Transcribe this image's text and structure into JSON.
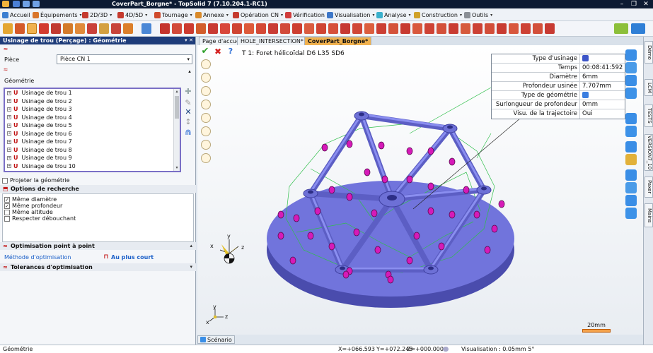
{
  "window": {
    "title": "CoverPart_Borgne* - TopSolid 7 (7.10.204.1-RC1)",
    "controls": [
      "–",
      "❐",
      "✕"
    ]
  },
  "menu": [
    {
      "label": "Accueil",
      "icon": "home-icon"
    },
    {
      "label": "Équipements",
      "icon": "equipment-icon"
    },
    {
      "label": "2D/3D",
      "icon": "2d3d-icon"
    },
    {
      "label": "4D/5D",
      "icon": "4d5d-icon"
    },
    {
      "label": "Tournage",
      "icon": "turning-icon"
    },
    {
      "label": "Annexe",
      "icon": "annex-icon"
    },
    {
      "label": "Opération CN",
      "icon": "cn-operation-icon"
    },
    {
      "label": "Vérification",
      "icon": "verification-icon"
    },
    {
      "label": "Visualisation",
      "icon": "visualisation-icon"
    },
    {
      "label": "Analyse",
      "icon": "analysis-icon"
    },
    {
      "label": "Construction",
      "icon": "construction-icon"
    },
    {
      "label": "Outils",
      "icon": "tools-icon"
    }
  ],
  "panel": {
    "title": "Usinage de trou (Perçage) : Géométrie",
    "header_buttons": "▾ ✕",
    "piece_label": "Pièce",
    "piece_value": "Pièce CN 1",
    "geometry_label": "Géométrie",
    "geometry_items": [
      "Usinage de trou 1",
      "Usinage de trou 2",
      "Usinage de trou 3",
      "Usinage de trou 4",
      "Usinage de trou 5",
      "Usinage de trou 6",
      "Usinage de trou 7",
      "Usinage de trou 8",
      "Usinage de trou 9",
      "Usinage de trou 10"
    ],
    "project_geometry_label": "Projeter la géométrie",
    "search_options_title": "Options de recherche",
    "search_options": [
      {
        "label": "Même diamètre",
        "checked": true
      },
      {
        "label": "Même profondeur",
        "checked": true
      },
      {
        "label": "Même altitude",
        "checked": false
      },
      {
        "label": "Respecter débouchant",
        "checked": false
      }
    ],
    "point_optimisation_title": "Optimisation point à point",
    "optimisation_method_label": "Méthode d'optimisation",
    "optimisation_method_value": "Au plus court",
    "optimisation_tolerances_title": "Tolerances d'optimisation"
  },
  "tabs": [
    {
      "label": "Page d'accueil",
      "active": false
    },
    {
      "label": "HOLE_INTERSECTION*",
      "active": false
    },
    {
      "label": "CoverPart_Borgne*",
      "active": true
    }
  ],
  "viewport": {
    "operation_title": "T 1: Foret hélicoïdal D6 L35 SD6",
    "properties": [
      {
        "key": "Type d'usinage",
        "value": "",
        "icon": "machining-type-icon"
      },
      {
        "key": "Temps",
        "value": "00:08:41:592"
      },
      {
        "key": "Diamètre",
        "value": "6mm"
      },
      {
        "key": "Profondeur usinée",
        "value": "7.707mm"
      },
      {
        "key": "Type de géométrie",
        "value": "",
        "icon": "geometry-type-icon"
      },
      {
        "key": "Surlongueur de profondeur",
        "value": "0mm"
      },
      {
        "key": "Visu. de la trajectoire",
        "value": "Oui"
      }
    ],
    "scale_label": "20mm",
    "axes": {
      "x": "x",
      "y": "y",
      "z": "z"
    }
  },
  "scenario_tab": "Scénario",
  "right_tabs": [
    "Démo",
    "LCM",
    "TESTS",
    "VERSION7_10",
    "Paxer",
    "Mains"
  ],
  "status": {
    "mode": "Géométrie",
    "x": "X=+066.593",
    "y": "Y=+072.248",
    "z": "Z=+000.000",
    "visualisation": "Visualisation : 0.05mm 5°"
  },
  "colors": {
    "title_bar": "#0d1b33",
    "panel_header": "#1e3c7a",
    "active_tab": "#f0b14e",
    "part_body": "#6d6fd8",
    "hole_markers": "#d61ab8",
    "toolpath": "#2fbf4a"
  }
}
